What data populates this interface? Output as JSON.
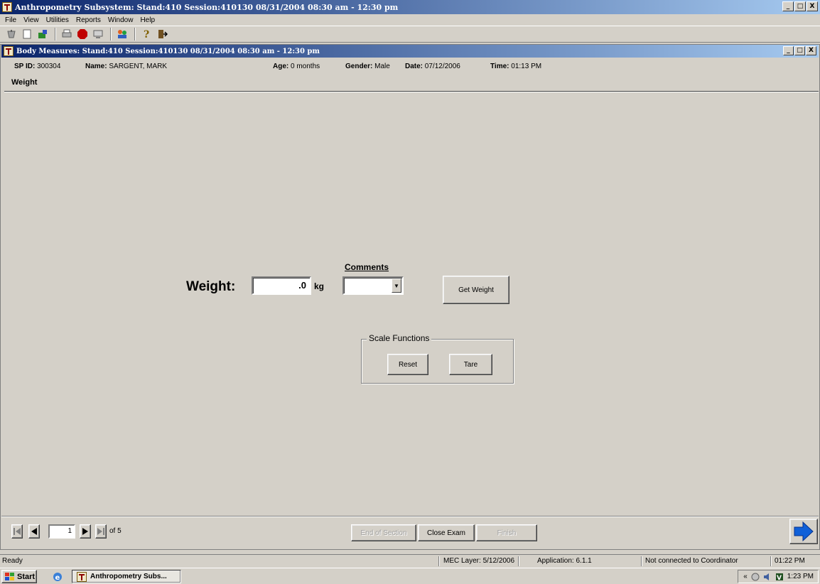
{
  "app": {
    "title": "Anthropometry Subsystem: Stand:410 Session:410130 08/31/2004 08:30 am - 12:30 pm",
    "window_buttons": [
      "_",
      "□",
      "X"
    ]
  },
  "menu": [
    "File",
    "View",
    "Utilities",
    "Reports",
    "Window",
    "Help"
  ],
  "toolbar": {
    "icons": [
      "new-icon",
      "blank-icon",
      "open-icon",
      "print-icon",
      "stop-icon",
      "computer-icon",
      "users-icon",
      "help-icon",
      "exit-icon"
    ]
  },
  "inner_window": {
    "title": "Body Measures: Stand:410 Session:410130 08/31/2004 08:30 am - 12:30 pm"
  },
  "participant": {
    "spid_label": "SP ID:",
    "spid": "300304",
    "name_label": "Name:",
    "name": "SARGENT, MARK",
    "age_label": "Age:",
    "age": "0 months",
    "gender_label": "Gender:",
    "gender": "Male",
    "date_label": "Date:",
    "date": "07/12/2006",
    "time_label": "Time:",
    "time": "01:13 PM"
  },
  "section": {
    "title": "Weight"
  },
  "form": {
    "weight_label": "Weight:",
    "weight_value": ".0",
    "unit": "kg",
    "comments_label": "Comments",
    "comments_value": "",
    "get_weight_button": "Get Weight",
    "scale_functions_label": "Scale Functions",
    "reset_button": "Reset",
    "tare_button": "Tare"
  },
  "navigation": {
    "page": "1",
    "of_label": "of 5",
    "end_of_section_button": "End of Section",
    "close_exam_button": "Close Exam",
    "finish_button": "Finish"
  },
  "statusbar": {
    "state": "Ready",
    "mec_layer": "MEC Layer: 5/12/2006",
    "application": "Application: 6.1.1",
    "coordinator": "Not connected to Coordinator",
    "time": "01:22 PM"
  },
  "taskbar": {
    "start_label": "Start",
    "task_label": "Anthropometry Subs...",
    "tray_chevron": "«",
    "clock": "1:23 PM"
  },
  "colors": {
    "titlebar_start": "#0a246a",
    "titlebar_end": "#a6caf0",
    "face": "#d4d0c8",
    "next_arrow": "#1060d8"
  }
}
